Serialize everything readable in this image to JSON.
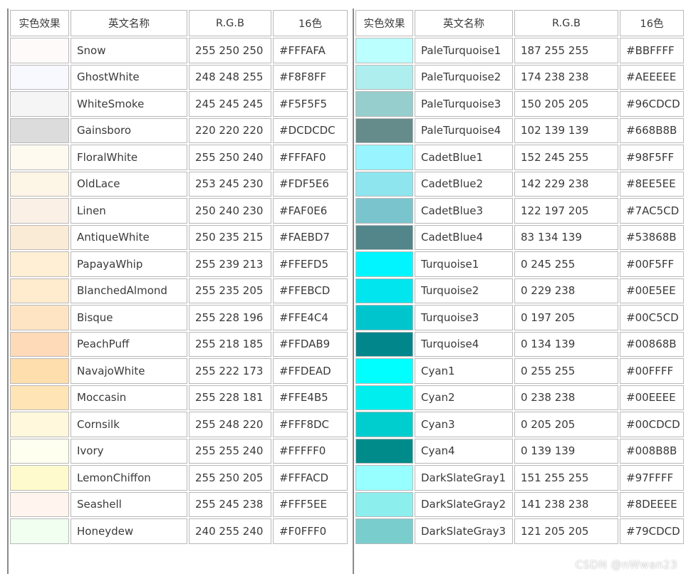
{
  "headers": [
    "实色效果",
    "英文名称",
    "R.G.B",
    "16色"
  ],
  "left_rows": [
    {
      "name": "Snow",
      "rgb": "255 250 250",
      "hex": "#FFFAFA"
    },
    {
      "name": "GhostWhite",
      "rgb": "248 248 255",
      "hex": "#F8F8FF"
    },
    {
      "name": "WhiteSmoke",
      "rgb": "245 245 245",
      "hex": "#F5F5F5"
    },
    {
      "name": "Gainsboro",
      "rgb": "220 220 220",
      "hex": "#DCDCDC"
    },
    {
      "name": "FloralWhite",
      "rgb": "255 250 240",
      "hex": "#FFFAF0"
    },
    {
      "name": "OldLace",
      "rgb": "253 245 230",
      "hex": "#FDF5E6"
    },
    {
      "name": "Linen",
      "rgb": "250 240 230",
      "hex": "#FAF0E6"
    },
    {
      "name": "AntiqueWhite",
      "rgb": "250 235 215",
      "hex": "#FAEBD7"
    },
    {
      "name": "PapayaWhip",
      "rgb": "255 239 213",
      "hex": "#FFEFD5"
    },
    {
      "name": "BlanchedAlmond",
      "rgb": "255 235 205",
      "hex": "#FFEBCD"
    },
    {
      "name": "Bisque",
      "rgb": "255 228 196",
      "hex": "#FFE4C4"
    },
    {
      "name": "PeachPuff",
      "rgb": "255 218 185",
      "hex": "#FFDAB9"
    },
    {
      "name": "NavajoWhite",
      "rgb": "255 222 173",
      "hex": "#FFDEAD"
    },
    {
      "name": "Moccasin",
      "rgb": "255 228 181",
      "hex": "#FFE4B5"
    },
    {
      "name": "Cornsilk",
      "rgb": "255 248 220",
      "hex": "#FFF8DC"
    },
    {
      "name": "Ivory",
      "rgb": "255 255 240",
      "hex": "#FFFFF0"
    },
    {
      "name": "LemonChiffon",
      "rgb": "255 250 205",
      "hex": "#FFFACD"
    },
    {
      "name": "Seashell",
      "rgb": "255 245 238",
      "hex": "#FFF5EE"
    },
    {
      "name": "Honeydew",
      "rgb": "240 255 240",
      "hex": "#F0FFF0"
    }
  ],
  "right_rows": [
    {
      "name": "PaleTurquoise1",
      "rgb": "187 255 255",
      "hex": "#BBFFFF"
    },
    {
      "name": "PaleTurquoise2",
      "rgb": "174 238 238",
      "hex": "#AEEEEE"
    },
    {
      "name": "PaleTurquoise3",
      "rgb": "150 205 205",
      "hex": "#96CDCD"
    },
    {
      "name": "PaleTurquoise4",
      "rgb": "102 139 139",
      "hex": "#668B8B"
    },
    {
      "name": "CadetBlue1",
      "rgb": "152 245 255",
      "hex": "#98F5FF"
    },
    {
      "name": "CadetBlue2",
      "rgb": "142 229 238",
      "hex": "#8EE5EE"
    },
    {
      "name": "CadetBlue3",
      "rgb": "122 197 205",
      "hex": "#7AC5CD"
    },
    {
      "name": "CadetBlue4",
      "rgb": "83 134 139",
      "hex": "#53868B"
    },
    {
      "name": "Turquoise1",
      "rgb": "0 245 255",
      "hex": "#00F5FF"
    },
    {
      "name": "Turquoise2",
      "rgb": "0 229 238",
      "hex": "#00E5EE"
    },
    {
      "name": "Turquoise3",
      "rgb": "0 197 205",
      "hex": "#00C5CD"
    },
    {
      "name": "Turquoise4",
      "rgb": "0 134 139",
      "hex": "#00868B"
    },
    {
      "name": "Cyan1",
      "rgb": "0 255 255",
      "hex": "#00FFFF"
    },
    {
      "name": "Cyan2",
      "rgb": "0 238 238",
      "hex": "#00EEEE"
    },
    {
      "name": "Cyan3",
      "rgb": "0 205 205",
      "hex": "#00CDCD"
    },
    {
      "name": "Cyan4",
      "rgb": "0 139 139",
      "hex": "#008B8B"
    },
    {
      "name": "DarkSlateGray1",
      "rgb": "151 255 255",
      "hex": "#97FFFF"
    },
    {
      "name": "DarkSlateGray2",
      "rgb": "141 238 238",
      "hex": "#8DEEEE"
    },
    {
      "name": "DarkSlateGray3",
      "rgb": "121 205 205",
      "hex": "#79CDCD"
    }
  ],
  "watermark": "CSDN @nWwan23"
}
